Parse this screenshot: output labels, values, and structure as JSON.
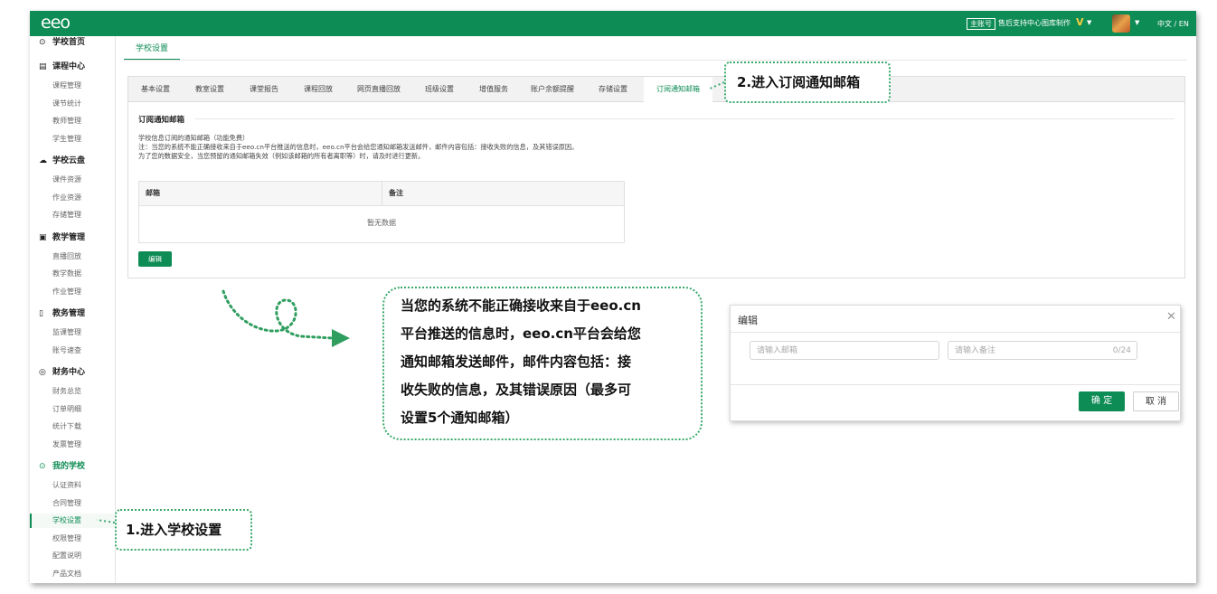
{
  "topbar": {
    "logo": "eeo",
    "role_badge": "主账号",
    "org_name": "售后支持中心图库制作",
    "vip": "V",
    "lang": "中文 / EN"
  },
  "sidebar": {
    "sections": [
      {
        "icon": "⊙",
        "label": "学校首页",
        "items": []
      },
      {
        "icon": "▤",
        "label": "课程中心",
        "items": [
          "课程管理",
          "课节统计",
          "教师管理",
          "学生管理"
        ]
      },
      {
        "icon": "☁",
        "label": "学校云盘",
        "items": [
          "课件资源",
          "作业资源",
          "存储管理"
        ]
      },
      {
        "icon": "▣",
        "label": "教学管理",
        "items": [
          "直播回放",
          "教学数据",
          "作业管理"
        ]
      },
      {
        "icon": "▯",
        "label": "教务管理",
        "items": [
          "监课管理",
          "账号速查"
        ]
      },
      {
        "icon": "◎",
        "label": "财务中心",
        "items": [
          "财务总览",
          "订单明细",
          "统计下载",
          "发票管理"
        ]
      },
      {
        "icon": "⊙",
        "label": "我的学校",
        "items": [
          "认证资料",
          "合同管理",
          "学校设置",
          "权限管理",
          "配置说明",
          "产品文档"
        ]
      }
    ]
  },
  "page_tab": "学校设置",
  "tabs": [
    "基本设置",
    "教室设置",
    "课堂报告",
    "课程回放",
    "网页直播回放",
    "班级设置",
    "增值服务",
    "账户余额提醒",
    "存储设置",
    "订阅通知邮箱"
  ],
  "active_tab": "订阅通知邮箱",
  "section": {
    "title": "订阅通知邮箱",
    "desc1": "学校信息订阅的通知邮箱（功能免费）",
    "desc2": "注：当您的系统不能正确接收来自于eeo.cn平台推送的信息时，eeo.cn平台会给您通知邮箱发送邮件，邮件内容包括：接收失败的信息，及其错误原因。",
    "desc3": "为了您的数据安全，当您预留的通知邮箱失效（例如该邮箱的所有者离职等）时，请及时进行更新。"
  },
  "table": {
    "columns": [
      "邮箱",
      "备注"
    ],
    "empty": "暂无数据"
  },
  "edit_button": "编辑",
  "callouts": {
    "step1": "1.进入学校设置",
    "step2": "2.进入订阅通知邮箱",
    "note_lines": [
      "当您的系统不能正确接收来自于eeo.cn",
      "平台推送的信息时，eeo.cn平台会给您",
      "通知邮箱发送邮件，邮件内容包括：接",
      "收失败的信息，及其错误原因（最多可",
      "设置5个通知邮箱）"
    ]
  },
  "dialog": {
    "title": "编辑",
    "email_placeholder": "请输入邮箱",
    "remark_placeholder": "请输入备注",
    "remark_count": "0/24",
    "confirm": "确 定",
    "cancel": "取 消"
  },
  "colors": {
    "brand": "#0e8c55",
    "callout_border": "#3aa86b"
  }
}
